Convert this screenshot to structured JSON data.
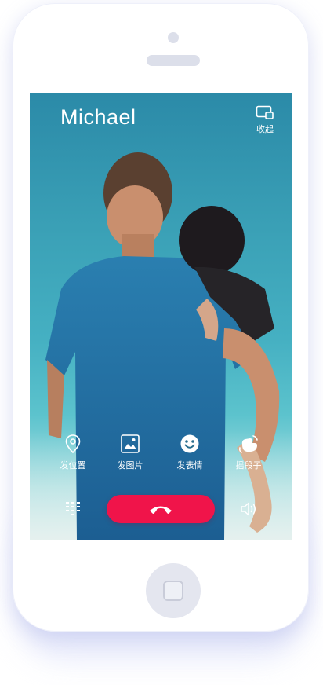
{
  "call": {
    "caller_name": "Michael",
    "minimize_label": "收起"
  },
  "actions": [
    {
      "label": "发位置",
      "icon": "location-pin-icon"
    },
    {
      "label": "发图片",
      "icon": "image-icon"
    },
    {
      "label": "发表情",
      "icon": "smiley-icon"
    },
    {
      "label": "摇段子",
      "icon": "shake-hand-icon"
    }
  ],
  "controls": {
    "keypad_icon": "keypad-icon",
    "hangup_icon": "phone-hangup-icon",
    "speaker_icon": "speaker-icon"
  },
  "colors": {
    "hangup": "#f0144a",
    "screen_top": "#2b8aa8",
    "screen_bottom": "#cfeef0"
  }
}
